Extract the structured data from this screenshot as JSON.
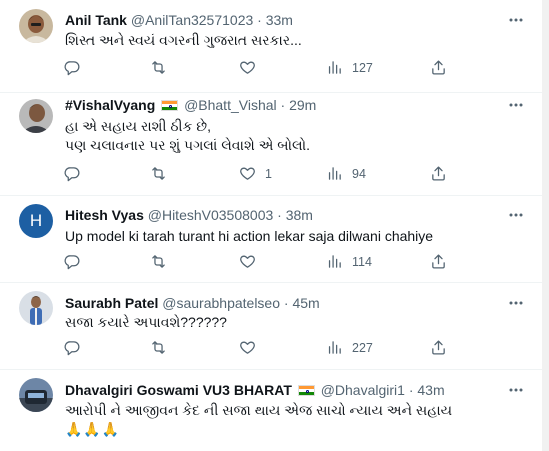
{
  "tweets": [
    {
      "name": "Anil Tank",
      "handle": "@AnilTan32571023",
      "dot": "·",
      "time": "33m",
      "lines": [
        "શિસ્ત અને સ્વયં વગરની ગુજરાત સરકાર..."
      ],
      "likes": "",
      "views": "127",
      "avatar": "photo"
    },
    {
      "name": "#VishalVyang",
      "handle": "@Bhatt_Vishal",
      "dot": "·",
      "time": "29m",
      "lines": [
        "હા એ સહાય રાશી ઠીક છે,",
        "પણ ચલાવનાર પર શું પગલાં લેવાશે એ બોલો."
      ],
      "likes": "1",
      "views": "94",
      "avatar": "photo"
    },
    {
      "name": "Hitesh Vyas",
      "handle": "@HiteshV03508003",
      "dot": "·",
      "time": "38m",
      "lines": [
        "Up model ki tarah turant hi action lekar saja dilwani chahiye"
      ],
      "likes": "",
      "views": "114",
      "avatar": "H"
    },
    {
      "name": "Saurabh Patel",
      "handle": "@saurabhpatelseo",
      "dot": "·",
      "time": "45m",
      "lines": [
        "સજા કયારે અપાવશે??????"
      ],
      "likes": "",
      "views": "227",
      "avatar": "photo"
    },
    {
      "name": "Dhavalgiri Goswami VU3 BHARAT",
      "handle": "@Dhavalgiri1",
      "dot": "·",
      "time": "43m",
      "lines": [
        "આરોપી ને આજીવન કેદ ની સજા થાય એજ સાચો ન્યાય અને સહાય"
      ],
      "emoji": "🙏🙏🙏",
      "likes": "",
      "views": "",
      "avatar": "photo"
    }
  ],
  "icons": {
    "more": "more-icon",
    "reply": "reply-icon",
    "retweet": "retweet-icon",
    "like": "like-icon",
    "views": "views-icon",
    "share": "share-icon"
  },
  "colors": {
    "text": "#0f1419",
    "secondary": "#536471",
    "border": "#eff3f4",
    "avatar_letter_bg": "#1d5fa3"
  }
}
